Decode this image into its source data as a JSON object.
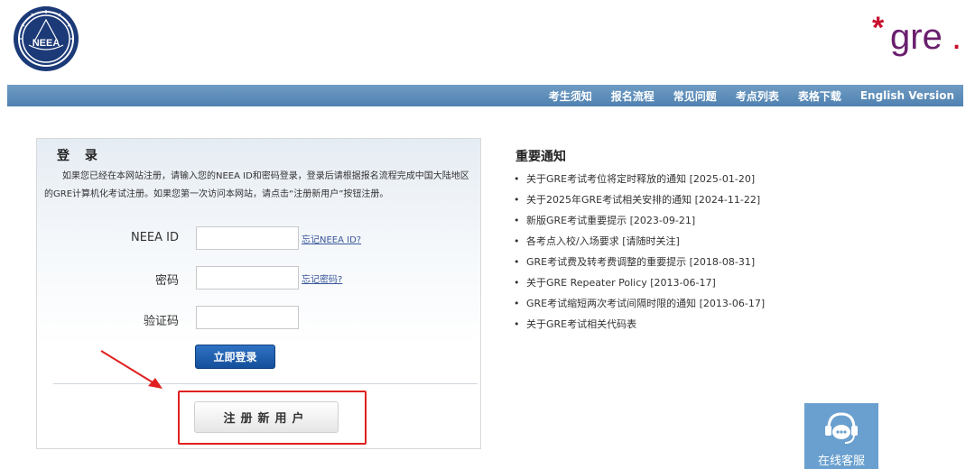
{
  "header": {
    "left_logo_icon": "neea-logo-icon",
    "left_logo_text": "NEEA",
    "right_logo_text": "gre",
    "right_logo_asterisk": "*",
    "right_logo_dot": "."
  },
  "nav": {
    "items": [
      {
        "label": "考生须知"
      },
      {
        "label": "报名流程"
      },
      {
        "label": "常见问题"
      },
      {
        "label": "考点列表"
      },
      {
        "label": "表格下载"
      },
      {
        "label": "English Version"
      }
    ]
  },
  "login": {
    "title": "登 录",
    "description": "如果您已经在本网站注册，请输入您的NEEA ID和密码登录，登录后请根据报名流程完成中国大陆地区的GRE计算机化考试注册。如果您第一次访问本网站，请点击“注册新用户”按钮注册。",
    "fields": [
      {
        "label": "NEEA ID",
        "value": "",
        "link": "忘记NEEA ID?"
      },
      {
        "label": "密码",
        "value": "",
        "link": "忘记密码?"
      },
      {
        "label": "验证码",
        "value": ""
      }
    ],
    "login_button": "立即登录",
    "register_button": "注册新用户"
  },
  "notices": {
    "title": "重要通知",
    "items": [
      {
        "text": "关于GRE考试考位将定时释放的通知 [2025-01-20]"
      },
      {
        "text": "关于2025年GRE考试相关安排的通知 [2024-11-22]"
      },
      {
        "text": "新版GRE考试重要提示 [2023-09-21]"
      },
      {
        "text": "各考点入校/入场要求 [请随时关注]"
      },
      {
        "text": "GRE考试费及转考费调整的重要提示 [2018-08-31]"
      },
      {
        "text": "关于GRE Repeater Policy [2013-06-17]"
      },
      {
        "text": "GRE考试缩短两次考试间隔时限的通知 [2013-06-17]"
      },
      {
        "text": "关于GRE考试相关代码表"
      }
    ]
  },
  "service": {
    "label": "在线客服",
    "icon": "headset-chat-icon"
  },
  "colors": {
    "nav_bar": "#5b8bb8",
    "login_button": "#1f5fae",
    "highlight": "#e02020",
    "gre_purple": "#6a1f6e",
    "gre_red": "#c8102e",
    "service_bg": "#6aa0cf"
  }
}
